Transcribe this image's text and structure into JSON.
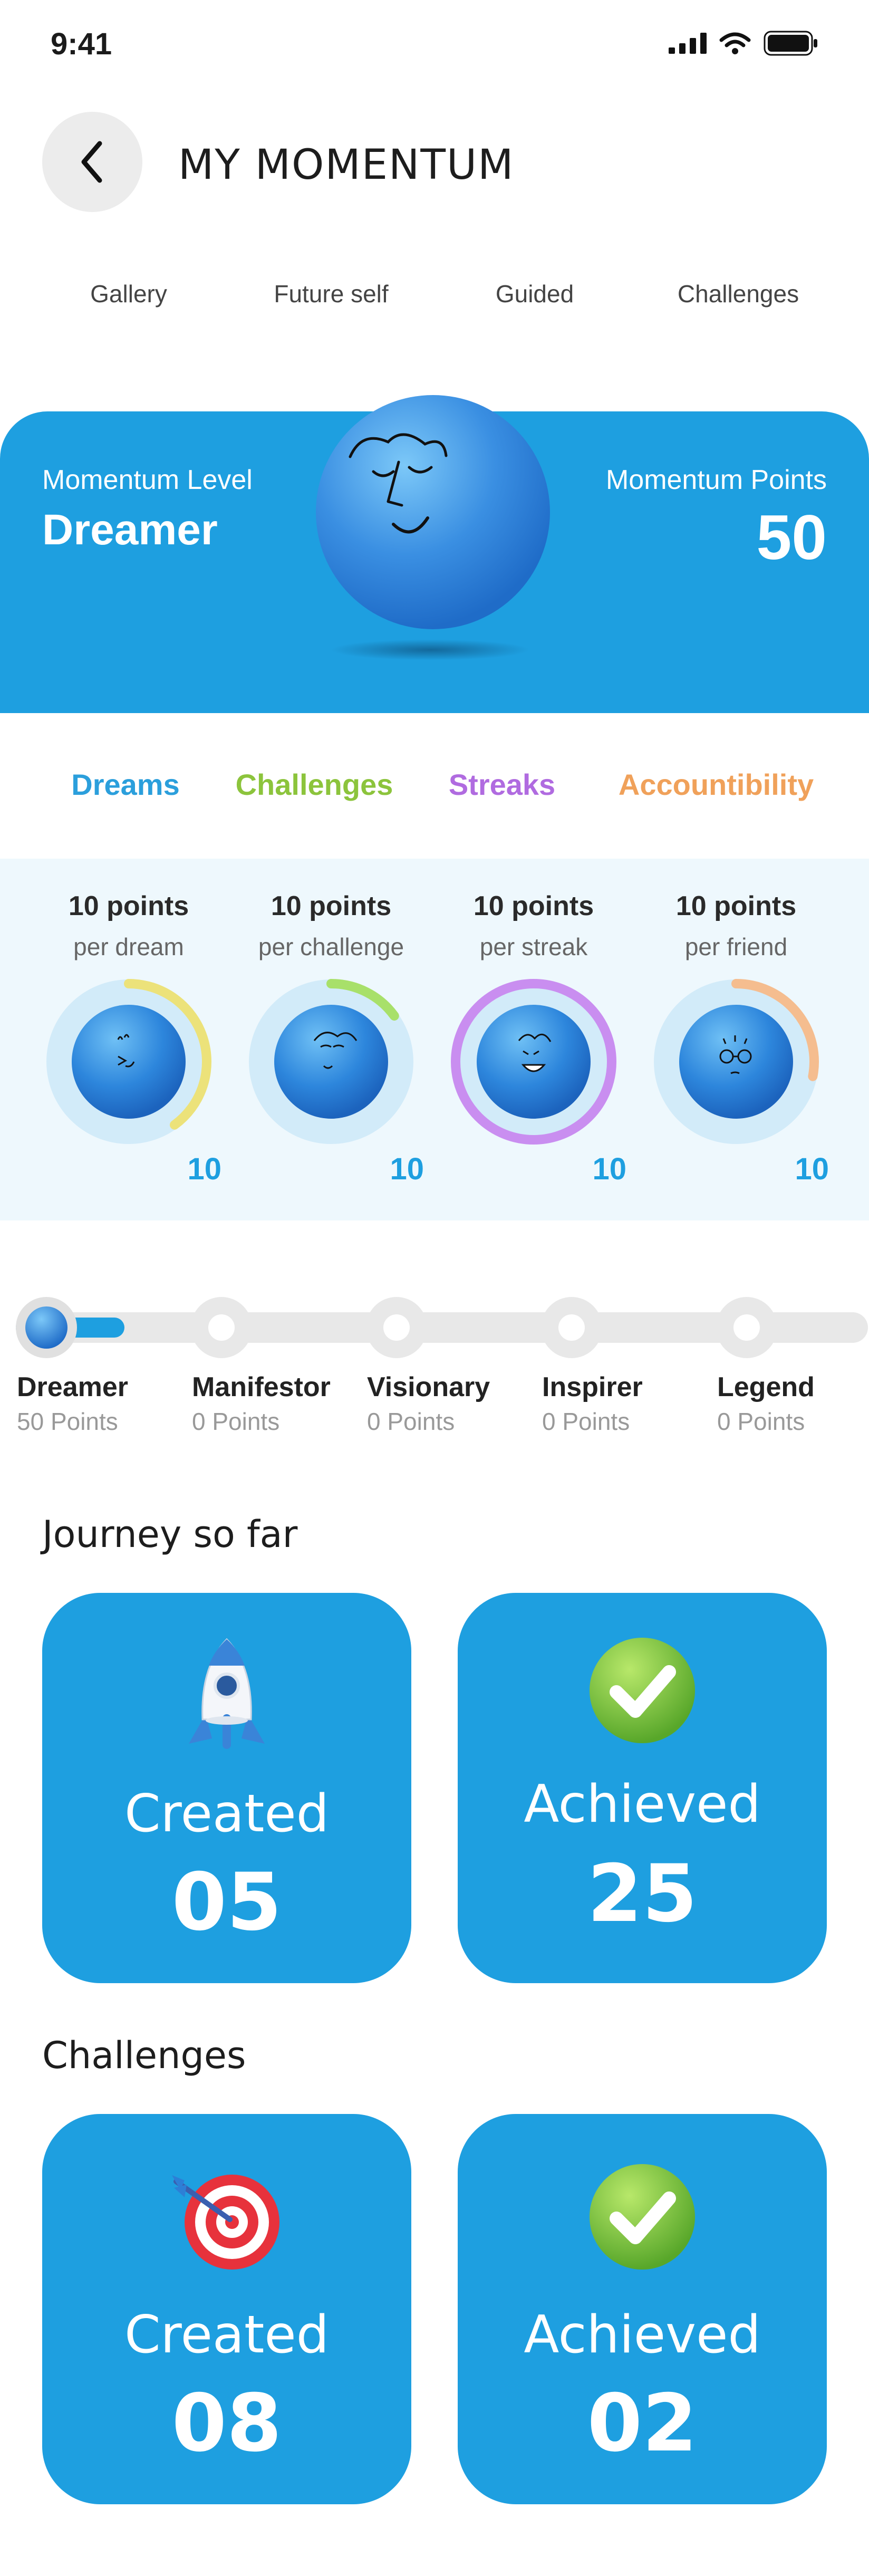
{
  "status": {
    "time": "9:41"
  },
  "header": {
    "title": "MY MOMENTUM"
  },
  "tabs": [
    {
      "label": "Gallery"
    },
    {
      "label": "Future self"
    },
    {
      "label": "Guided"
    },
    {
      "label": "Challenges"
    }
  ],
  "hero": {
    "level_label": "Momentum Level",
    "level_value": "Dreamer",
    "points_label": "Momentum Points",
    "points_value": "50"
  },
  "categories": [
    {
      "label": "Dreams",
      "color": "#2b9fdc"
    },
    {
      "label": "Challenges",
      "color": "#8cc43c"
    },
    {
      "label": "Streaks",
      "color": "#b06be0"
    },
    {
      "label": "Accountibility",
      "color": "#f0a15a"
    }
  ],
  "points": [
    {
      "title": "10 points",
      "sub": "per dream",
      "value": "10",
      "ring_color": "#ece27a",
      "progress": 0.4
    },
    {
      "title": "10 points",
      "sub": "per challenge",
      "value": "10",
      "ring_color": "#a8e06a",
      "progress": 0.15
    },
    {
      "title": "10 points",
      "sub": "per streak",
      "value": "10",
      "ring_color": "#c98ef0",
      "progress": 1.0
    },
    {
      "title": "10 points",
      "sub": "per friend",
      "value": "10",
      "ring_color": "#f5bd8f",
      "progress": 0.28
    }
  ],
  "levels": [
    {
      "name": "Dreamer",
      "points": "50 Points"
    },
    {
      "name": "Manifestor",
      "points": "0 Points"
    },
    {
      "name": "Visionary",
      "points": "0 Points"
    },
    {
      "name": "Inspirer",
      "points": "0 Points"
    },
    {
      "name": "Legend",
      "points": "0 Points"
    }
  ],
  "journey": {
    "title": "Journey so far",
    "created_label": "Created",
    "created_value": "05",
    "achieved_label": "Achieved",
    "achieved_value": "25"
  },
  "challenges": {
    "title": "Challenges",
    "created_label": "Created",
    "created_value": "08",
    "achieved_label": "Achieved",
    "achieved_value": "02"
  },
  "colors": {
    "accent": "#1e9fe0",
    "panel": "#eef8fd"
  }
}
